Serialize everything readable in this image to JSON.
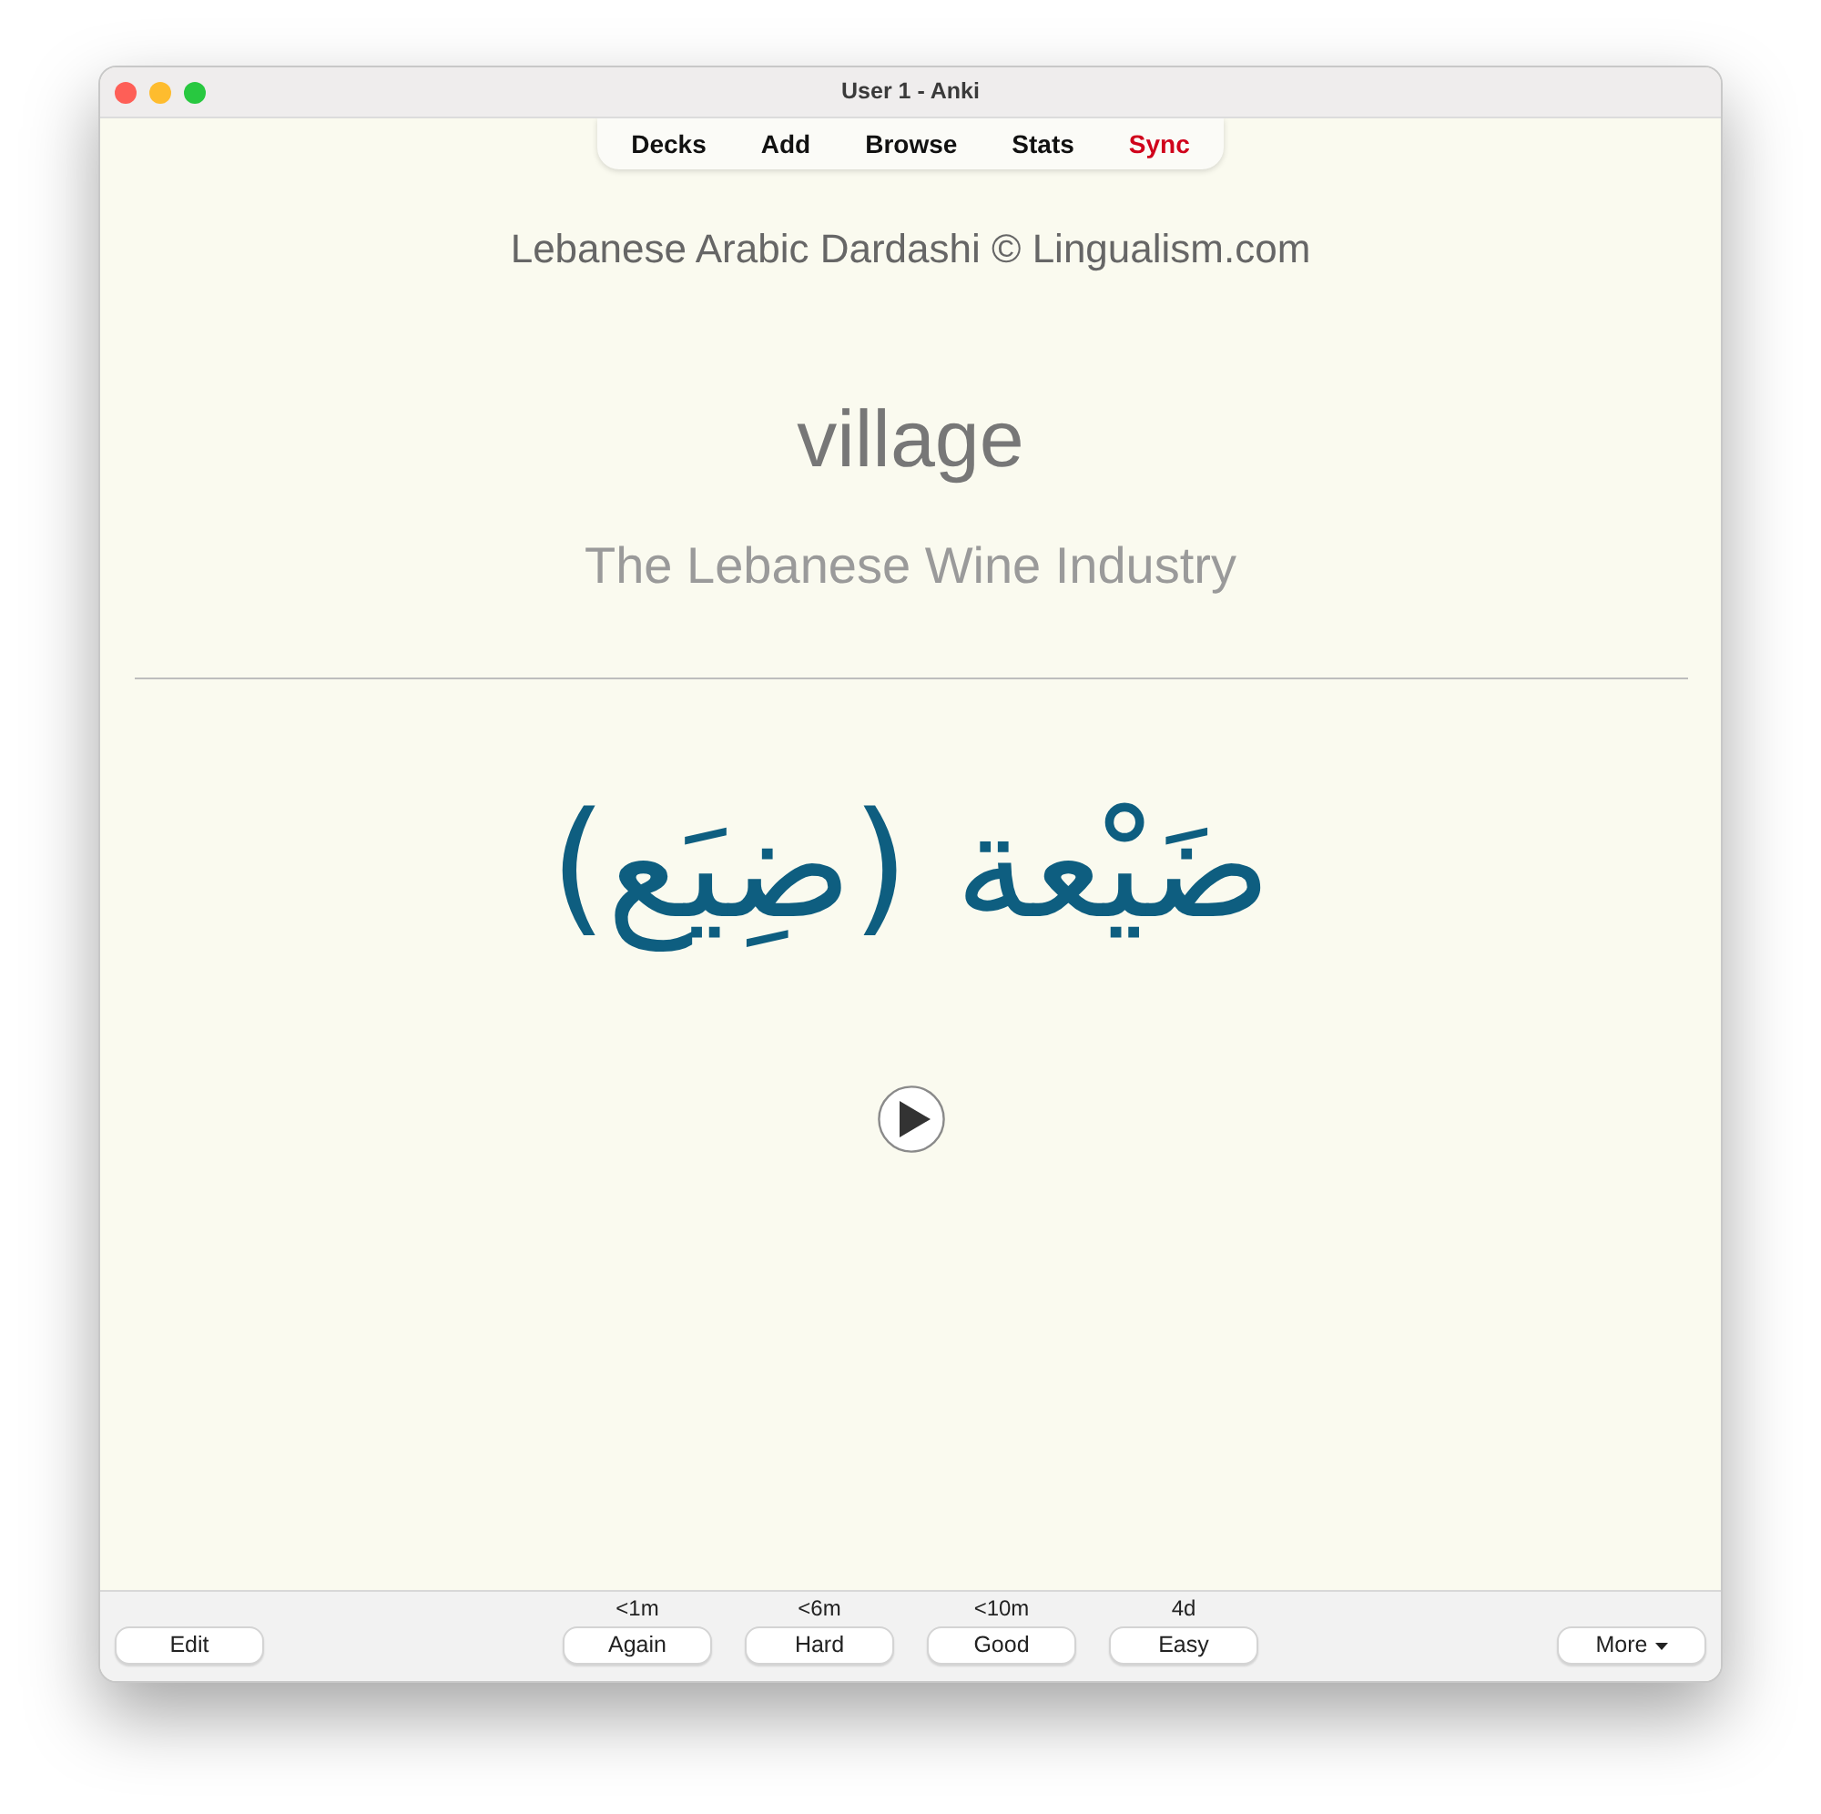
{
  "window": {
    "title": "User 1 - Anki"
  },
  "toolbar": {
    "items": [
      {
        "label": "Decks",
        "highlighted": false
      },
      {
        "label": "Add",
        "highlighted": false
      },
      {
        "label": "Browse",
        "highlighted": false
      },
      {
        "label": "Stats",
        "highlighted": false
      },
      {
        "label": "Sync",
        "highlighted": true
      }
    ]
  },
  "card": {
    "header": "Lebanese Arabic Dardashi © Lingualism.com",
    "word": "village",
    "topic": "The Lebanese Wine Industry",
    "answer": "ضَيْعة (ضِيَع)"
  },
  "bottom_bar": {
    "edit_button": "Edit",
    "answers": [
      {
        "time": "<1m",
        "label": "Again"
      },
      {
        "time": "<6m",
        "label": "Hard"
      },
      {
        "time": "<10m",
        "label": "Good"
      },
      {
        "time": "4d",
        "label": "Easy"
      }
    ],
    "more_button": "More"
  }
}
